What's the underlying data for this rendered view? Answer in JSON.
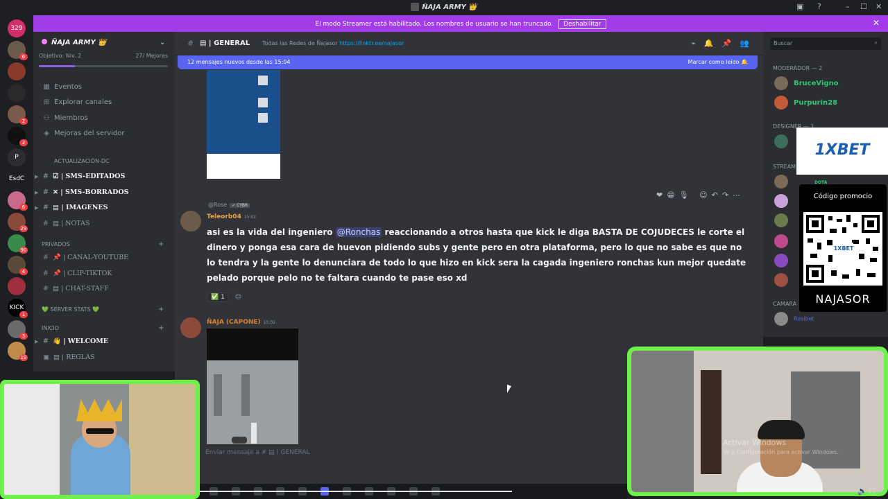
{
  "window": {
    "title": "ÑAJA ARMY 👑",
    "controls": [
      "▣",
      "?",
      "–",
      "☐",
      "✕"
    ]
  },
  "streamer_banner": {
    "text": "El modo Streamer está habilitado. Los nombres de usuario se han truncado.",
    "button": "Deshabilitar",
    "close": "✕"
  },
  "server_rail": [
    {
      "label": "329",
      "badge": ""
    },
    {
      "label": "",
      "badge": "6"
    },
    {
      "label": "",
      "badge": ""
    },
    {
      "label": "",
      "badge": ""
    },
    {
      "label": "",
      "badge": "2"
    },
    {
      "label": "",
      "badge": "2"
    },
    {
      "label": "P",
      "badge": ""
    },
    {
      "label": "EsdC",
      "badge": ""
    },
    {
      "label": "",
      "badge": "6"
    },
    {
      "label": "",
      "badge": "29"
    },
    {
      "label": "",
      "badge": "90"
    },
    {
      "label": "",
      "badge": "4"
    },
    {
      "label": "",
      "badge": ""
    },
    {
      "label": "KICK",
      "badge": "1"
    },
    {
      "label": "",
      "badge": "3"
    },
    {
      "label": "",
      "badge": "19"
    }
  ],
  "sidebar": {
    "server_name": "ÑAJA ARMY 👑",
    "objective": "Objetivo: Niv. 2",
    "boosts": "27/ Mejoras",
    "progress": 0.28,
    "nav": [
      {
        "icon": "▦",
        "label": "Eventos"
      },
      {
        "icon": "⊞",
        "label": "Explorar canales"
      },
      {
        "icon": "⚇",
        "label": "Miembros"
      },
      {
        "icon": "◈",
        "label": "Mejoras del servidor"
      }
    ],
    "cat_actualizacion": "ACTUALIZACIÓN-DC",
    "cat_privados": "PRIVADOS",
    "cat_stats": "💚 SERVER STATS 💚",
    "cat_inicio": "INICIO",
    "channels": {
      "sms_editados": "☑ | SMS-EDITADOS",
      "sms_borrados": "✕ | SMS-BORRADOS",
      "imagenes": "▤ | IMAGENES",
      "notas": "▤ | NOTAS",
      "canal_youtube": "📌 | CANAL-YOUTUBE",
      "clip_tiktok": "📌 | CLIP-TIKTOK",
      "chat_staff": "▤ | CHAT-STAFF",
      "welcome": "👋 | WELCOME",
      "reglas": "▤ | REGLAS"
    }
  },
  "header": {
    "channel": "▤ | GENERAL",
    "topic": "Todas las Redes de Ñajasor",
    "topic_link": "https://linktr.ee/najasor",
    "icons": "⌁🔔📌👥"
  },
  "new_messages_bar": {
    "left": "12 mensajes nuevos desde las 15:04",
    "right": "Marcar como leído 🔔"
  },
  "reaction_toolbar": "❤😁🎙 ☺↶↷⋯",
  "message1": {
    "reply_to": "@Rose",
    "reply_tag": "✓ CYBR",
    "author": "Teleorb04",
    "time": "15:02",
    "text_before": "asi es la vida del ingeniero ",
    "mention": "@Ronchas",
    "text_after": " reaccionando a otros hasta que kick le diga BASTA DE COJUDECES le corte el dinero y ponga esa cara de huevon pidiendo subs y gente pero en otra plataforma, pero lo que no sabe es que no lo tendra y la gente lo denunciara de todo lo que hizo en kick sera la cagada ingeniero ronchas kun mejor quedate pelado porque pelo no te faltara cuando te pase eso xd",
    "reaction": "✅ 1",
    "add_reaction": "☺"
  },
  "message2": {
    "author": "ÑAJA (CAPONE)",
    "time": "15:02"
  },
  "composer": {
    "placeholder": "Enviar mensaje a # ▤ | GENERAL"
  },
  "members": {
    "search_placeholder": "Buscar",
    "moderators_header": "MODERADOR — 2",
    "moderators": [
      "BruceVigno",
      "Purpurin28"
    ],
    "designer_header": "DESIGNER — 1",
    "stream_header": "STREAM",
    "camera_header": "CAMARA",
    "camera_member": "Rosibet",
    "dota_tag": "DOTA"
  },
  "ads": {
    "brand": "1XBET",
    "promo_title": "Código promocio",
    "promo_name": "NAJASOR"
  },
  "watermark": {
    "line1": "Activar Windows",
    "line2": "Ve a Configuración para activar Windows."
  },
  "colors": {
    "banner": "#a13ce8",
    "blurple": "#5865f2",
    "online": "#2dc770",
    "webcam_border": "#6ff04a"
  }
}
